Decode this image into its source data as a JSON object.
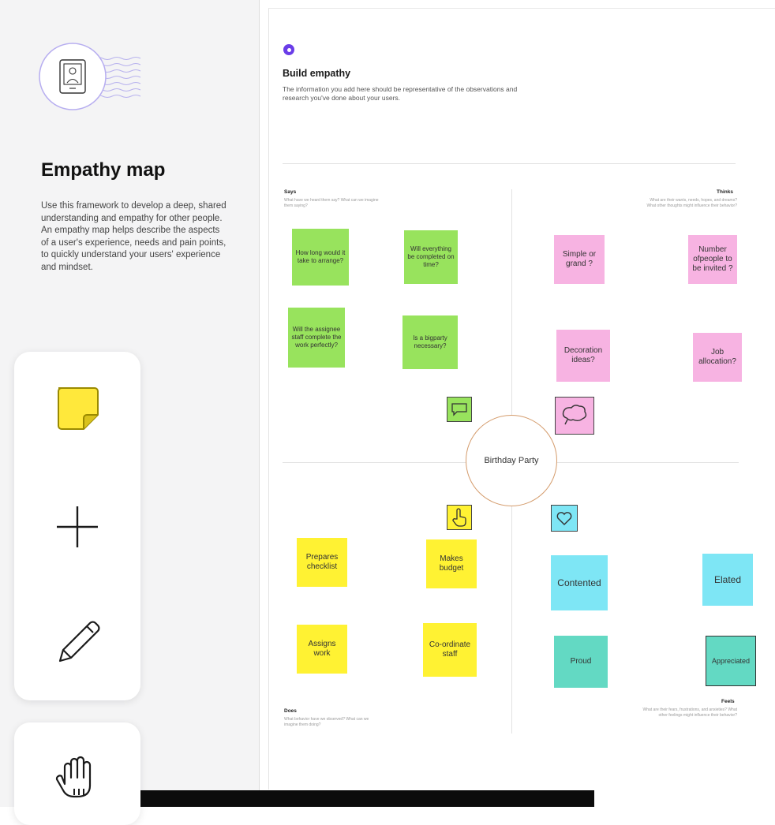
{
  "left_panel": {
    "title": "Empathy map",
    "description": "Use this framework to develop a deep, shared understanding and empathy for other people. An empathy map helps describe the aspects of a user's experience, needs and pain points, to quickly understand your users' experience and mindset.",
    "hero_icon": "profile-card-icon"
  },
  "toolbar": {
    "tools": [
      {
        "name": "sticky-note",
        "icon": "sticky-note-icon",
        "color": "#ffe83b"
      },
      {
        "name": "add",
        "icon": "plus-icon"
      },
      {
        "name": "pen",
        "icon": "pencil-icon"
      },
      {
        "name": "hand",
        "icon": "hand-icon"
      }
    ]
  },
  "canvas": {
    "header": {
      "title": "Build empathy",
      "description": "The information you add here should be representative of the observations and research you've done about your users."
    },
    "center_label": "Birthday Party",
    "quadrants": {
      "says": {
        "label": "Says",
        "hint": "What have we heard them say? What can we imagine them saying?",
        "icon": "speech-bubble-icon",
        "notes": [
          "How long would it take to arrange?",
          "Will everything be completed on time?",
          "Will the assignee staff complete the work perfectly?",
          "Is a bigparty necessary?"
        ]
      },
      "thinks": {
        "label": "Thinks",
        "hint": "What are their wants, needs, hopes, and dreams? What other thoughts might influence their behavior?",
        "icon": "thought-bubble-icon",
        "notes": [
          "Simple or grand ?",
          "Number ofpeople to be invited ?",
          "Decoration ideas?",
          "Job allocation?"
        ]
      },
      "does": {
        "label": "Does",
        "hint": "What behavior have we observed? What can we imagine them doing?",
        "icon": "pointer-hand-icon",
        "notes": [
          "Prepares checklist",
          "Makes budget",
          "Assigns work",
          "Co-ordinate staff"
        ]
      },
      "feels": {
        "label": "Feels",
        "hint": "What are their fears, frustrations, and anxieties? What other feelings might influence their behavior?",
        "icon": "heart-icon",
        "notes": [
          "Contented",
          "Elated",
          "Proud",
          "Appreciated"
        ]
      }
    }
  },
  "colors": {
    "accent": "#6a3de8",
    "says_note": "#98e35d",
    "thinks_note": "#f7b3e2",
    "does_note": "#fff233",
    "feels_note": "#7ee6f5",
    "feels_note_alt": "#63d9c3",
    "center_border": "#d49b6b"
  }
}
